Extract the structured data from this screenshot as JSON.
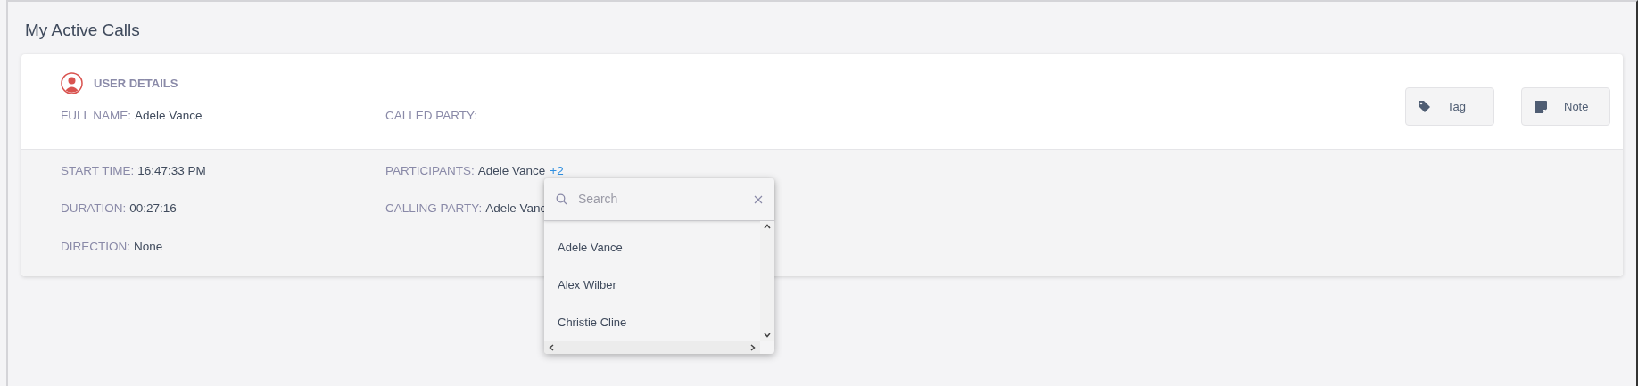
{
  "page_title": "My Active Calls",
  "user_details": {
    "heading": "USER DETAILS",
    "fields": [
      {
        "label": "FULL NAME:",
        "value": "Adele Vance"
      },
      {
        "label": "CALLED PARTY:"
      }
    ]
  },
  "actions": [
    {
      "kind": "tag",
      "label": "Tag"
    },
    {
      "kind": "note",
      "label": "Note"
    }
  ],
  "call_details": {
    "left": [
      {
        "label": "START TIME:",
        "value": "16:47:33 PM"
      },
      {
        "label": "DURATION:",
        "value": "00:27:16"
      },
      {
        "label": "DIRECTION:",
        "value": "None"
      }
    ],
    "right": [
      {
        "label": "PARTICIPANTS:",
        "value": "Adele Vance",
        "more": "+2"
      },
      {
        "label": "CALLING PARTY:",
        "value": "Adele Vanc"
      }
    ]
  },
  "participants_dropdown": {
    "search": {
      "placeholder": "Search"
    },
    "items": [
      "Adele Vance",
      "Alex Wilber",
      "Christie Cline"
    ]
  }
}
